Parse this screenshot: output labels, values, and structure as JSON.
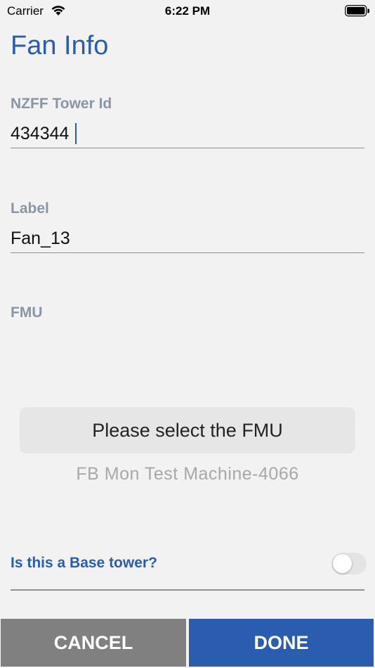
{
  "status_bar": {
    "carrier": "Carrier",
    "time": "6:22 PM",
    "wifi_icon": "wifi-icon",
    "battery_icon": "battery-icon"
  },
  "page": {
    "title": "Fan Info"
  },
  "form": {
    "tower_id": {
      "label": "NZFF Tower Id",
      "value": "434344"
    },
    "fan_label": {
      "label": "Label",
      "value": "Fan_13"
    },
    "fmu": {
      "label": "FMU",
      "button_label": "Please select the FMU",
      "selected_value": "FB Mon Test Machine-4066"
    },
    "base_tower": {
      "question": "Is this a Base tower?",
      "checked": false
    }
  },
  "actions": {
    "cancel_label": "CANCEL",
    "done_label": "DONE"
  },
  "colors": {
    "accent": "#2a5db0",
    "cancel_bg": "#808080",
    "background": "#f2f2f2"
  }
}
